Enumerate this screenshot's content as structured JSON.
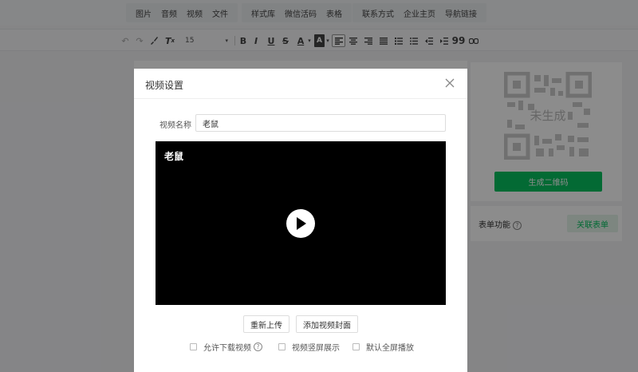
{
  "topbar": {
    "groups": [
      [
        "图片",
        "音频",
        "视频",
        "文件"
      ],
      [
        "样式库",
        "微信活码",
        "表格"
      ],
      [
        "联系方式",
        "企业主页",
        "导航链接"
      ]
    ]
  },
  "toolbar": {
    "font_size": "15",
    "bold": "B",
    "italic": "I",
    "underline": "U",
    "strike": "S",
    "font_color": "A",
    "bg_color": "A",
    "quote": "99"
  },
  "qr": {
    "placeholder": "未生成",
    "generate_label": "生成二维码"
  },
  "form": {
    "label": "表单功能",
    "help": "?",
    "link_label": "关联表单"
  },
  "modal": {
    "title": "视频设置",
    "name_label": "视频名称",
    "name_value": "老鼠",
    "video_title": "老鼠",
    "reupload_label": "重新上传",
    "add_cover_label": "添加视频封面",
    "options": {
      "allow_download": "允许下载视频",
      "allow_download_help": "?",
      "vertical_display": "视频竖屏展示",
      "default_fullscreen": "默认全屏播放"
    }
  },
  "colors": {
    "accent": "#07c160",
    "overlay": "rgba(0,0,0,0.45)"
  }
}
